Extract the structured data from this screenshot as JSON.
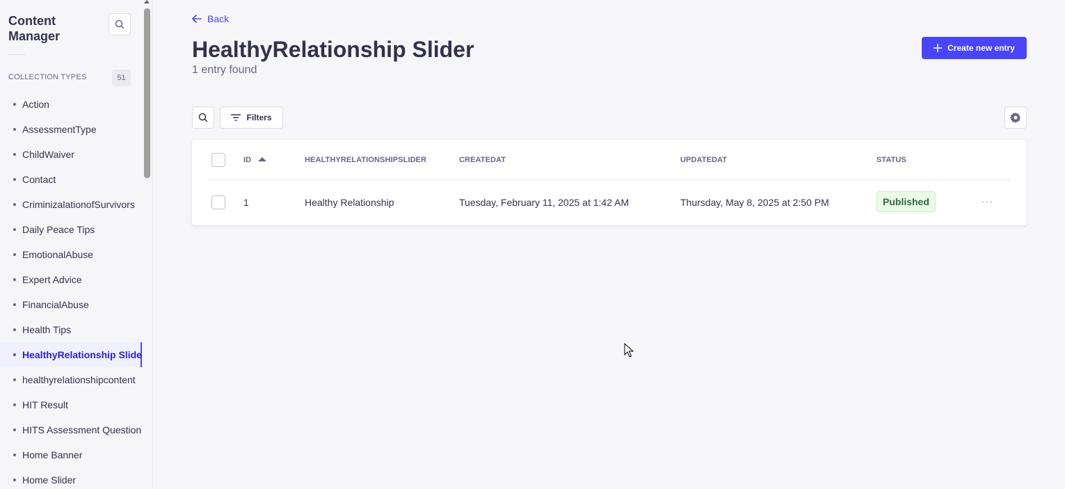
{
  "sidebar": {
    "title": "Content Manager",
    "section_label": "COLLECTION TYPES",
    "count": "51",
    "items": [
      "Action",
      "AssessmentType",
      "ChildWaiver",
      "Contact",
      "CriminizalationofSurvivors",
      "Daily Peace Tips",
      "EmotionalAbuse",
      "Expert Advice",
      "FinancialAbuse",
      "Health Tips",
      "HealthyRelationship Slider",
      "healthyrelationshipcontent",
      "HIT Result",
      "HITS Assessment Question",
      "Home Banner",
      "Home Slider"
    ],
    "active_index": 10
  },
  "header": {
    "back_label": "Back",
    "title": "HealthyRelationship Slider",
    "subtitle": "1 entry found",
    "create_label": "Create new entry"
  },
  "toolbar": {
    "filters_label": "Filters"
  },
  "table": {
    "columns": [
      "ID",
      "HEALTHYRELATIONSHIPSLIDER",
      "CREATEDAT",
      "UPDATEDAT",
      "STATUS"
    ],
    "sort": "ascending",
    "rows": [
      {
        "id": "1",
        "name": "Healthy Relationship",
        "created": "Tuesday, February 11, 2025 at 1:42 AM",
        "updated": "Thursday, May 8, 2025 at 2:50 PM",
        "status": "Published",
        "more": "···"
      }
    ]
  },
  "colors": {
    "primary": "#4945ff",
    "published_bg": "#eafbe7",
    "published_text": "#2f6846"
  }
}
